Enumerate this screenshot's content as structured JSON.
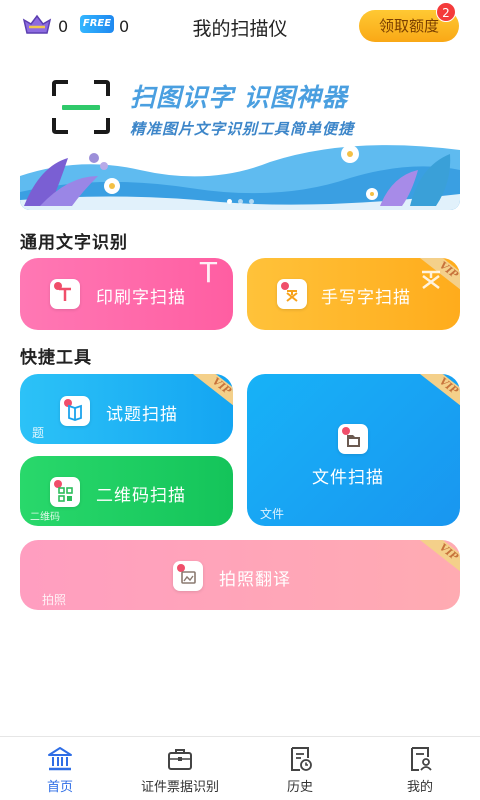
{
  "header": {
    "vip_count": "0",
    "free_badge": "FREE",
    "free_count": "0",
    "title": "我的扫描仪",
    "claim_button": "领取额度",
    "claim_badge": "2",
    "accent": "#f9a816"
  },
  "banner": {
    "headline": "扫图识字 识图神器",
    "subline": "精准图片文字识别工具简单便捷",
    "slide_count": 3,
    "active_slide": 1
  },
  "sections": {
    "ocr_title": "通用文字识别",
    "tools_title": "快捷工具"
  },
  "cards": {
    "print_scan": {
      "label": "印刷字扫描",
      "watermark": "T",
      "color": "#ff6fae"
    },
    "handwriting_scan": {
      "label": "手写字扫描",
      "vip": "VIP",
      "color": "#ffb82b"
    },
    "exam_scan": {
      "label": "试题扫描",
      "vip": "VIP",
      "watermark": "题",
      "color": "#1fb4f5"
    },
    "file_scan": {
      "label": "文件扫描",
      "vip": "VIP",
      "watermark": "文件",
      "color": "#1ea6f5"
    },
    "qr_scan": {
      "label": "二维码扫描",
      "watermark": "二维码",
      "color": "#24d064"
    },
    "photo_translate": {
      "label": "拍照翻译",
      "vip": "VIP",
      "watermark": "拍照",
      "color": "#ffa4b8"
    }
  },
  "nav": {
    "home": "首页",
    "id_ticket": "证件票据识别",
    "history": "历史",
    "mine": "我的",
    "active": "home",
    "active_color": "#2f6ee6"
  }
}
